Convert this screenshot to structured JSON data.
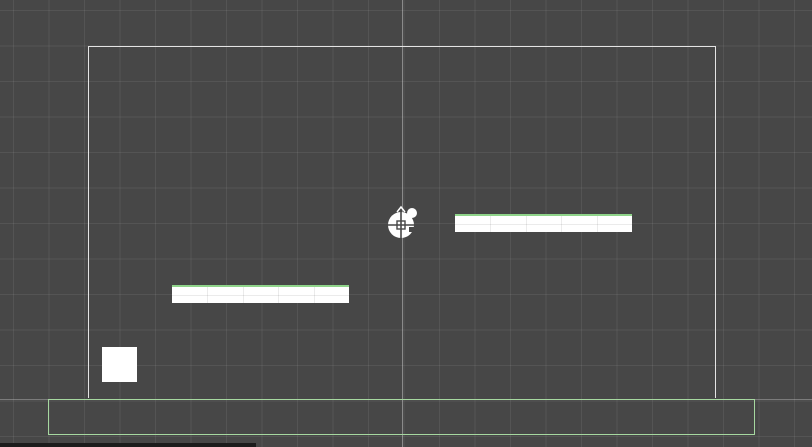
{
  "scene": {
    "background_color": "#474747",
    "grid_color": "rgba(255,255,255,0.07)",
    "camera_outline_color": "#e4e4e4",
    "collider_outline_color": "#a6d8a0",
    "platform_color": "#ffffff",
    "platform_edge_color": "#8fd48a"
  },
  "objects": {
    "player": {
      "icon": "player-character-icon"
    },
    "platforms": [
      "platform-left",
      "platform-right"
    ],
    "block": {
      "icon": "square-block-icon"
    }
  }
}
